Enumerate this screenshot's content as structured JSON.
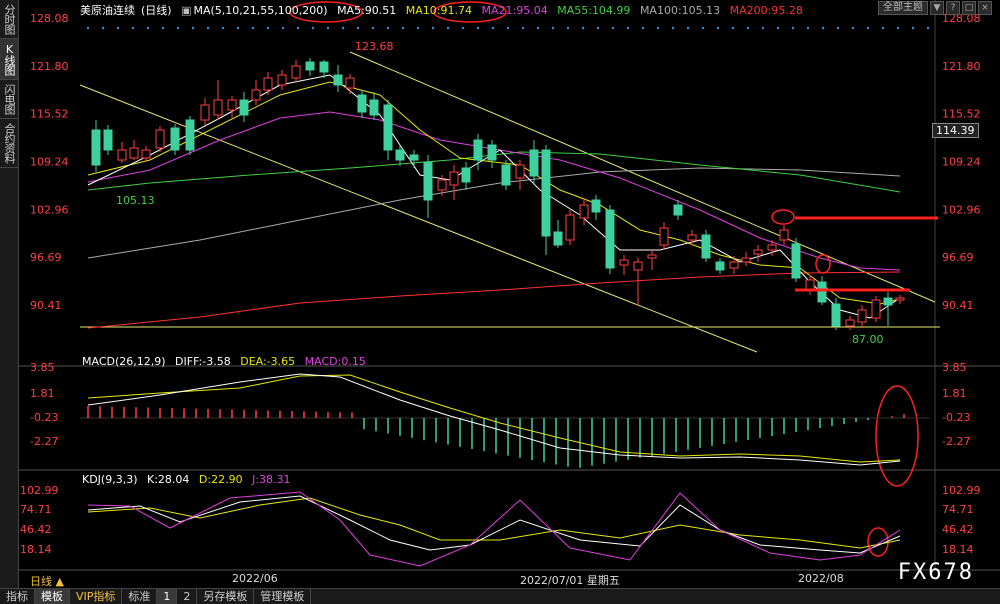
{
  "sidebar": {
    "tabs": [
      "分时图",
      "K线图",
      "闪电图",
      "合约资料"
    ],
    "active": 1
  },
  "header": {
    "symbol": "美原油连续",
    "period_tag": "日线",
    "ma_params": "MA(5,10,21,55,100,200)",
    "ma5": "MA5:90.51",
    "ma10": "MA10:91.74",
    "ma21": "MA21:95.04",
    "ma55": "MA55:104.99",
    "ma100": "MA100:105.13",
    "ma200": "MA200:95.28",
    "theme_button": "全部主题"
  },
  "price_axis": {
    "ticks": [
      "128.08",
      "121.80",
      "115.52",
      "109.24",
      "102.96",
      "96.69",
      "90.41"
    ],
    "current_price": "114.39"
  },
  "annotations": {
    "high": "123.68",
    "low": "87.00",
    "mid_low": "105.13"
  },
  "macd": {
    "label": "MACD(26,12,9)",
    "diff": "DIFF:-3.58",
    "dea": "DEA:-3.65",
    "macd": "MACD:0.15",
    "ticks": [
      "3.85",
      "1.81",
      "-0.23",
      "-2.27"
    ]
  },
  "kdj": {
    "label": "KDJ(9,3,3)",
    "k": "K:28.04",
    "d": "D:22.90",
    "j": "J:38.31",
    "ticks": [
      "102.99",
      "74.71",
      "46.42",
      "18.14"
    ]
  },
  "date_axis": {
    "left": "2022/06",
    "mid": "2022/07/01 星期五",
    "right": "2022/08"
  },
  "period_selector": "日线 ▲",
  "bottom_tabs": [
    "指标",
    "模板",
    "VIP指标",
    "标准",
    "1",
    "2",
    "另存模板",
    "管理模板"
  ],
  "watermark": "FX678",
  "colors": {
    "up": "#ff4040",
    "down": "#40d0a0",
    "ma5": "#ffffff",
    "ma10": "#e8e800",
    "ma21": "#e040e0",
    "ma55": "#40d040",
    "ma100": "#aaaaaa",
    "ma200": "#ff3030"
  }
}
